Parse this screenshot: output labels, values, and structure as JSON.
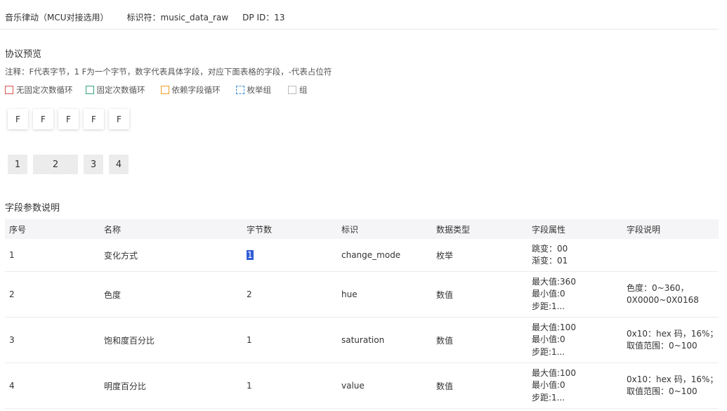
{
  "header": {
    "title": "音乐律动（MCU对接选用）",
    "identifier": "标识符：music_data_raw",
    "dp_id": "DP ID：13"
  },
  "protocol": {
    "title": "协议预览",
    "note": "注释：F代表字节，1 F为一个字节，数字代表具体字段，对应下面表格的字段，-代表占位符",
    "legend": [
      {
        "label": "无固定次数循环",
        "color": "#d9534f",
        "style": "solid"
      },
      {
        "label": "固定次数循环",
        "color": "#3aa17e",
        "style": "solid"
      },
      {
        "label": "依赖字段循环",
        "color": "#f0a020",
        "style": "solid"
      },
      {
        "label": "枚举组",
        "color": "#3b8fd9",
        "style": "dashed"
      },
      {
        "label": "组",
        "color": "#bbbbbb",
        "style": "solid"
      }
    ],
    "bytes": [
      "F",
      "F",
      "F",
      "F",
      "F"
    ],
    "fields": [
      {
        "label": "1",
        "bytes": 1
      },
      {
        "label": "2",
        "bytes": 2
      },
      {
        "label": "3",
        "bytes": 1
      },
      {
        "label": "4",
        "bytes": 1
      }
    ]
  },
  "fields_section": {
    "title": "字段参数说明",
    "columns": [
      "序号",
      "名称",
      "字节数",
      "标识",
      "数据类型",
      "字段属性",
      "字段说明"
    ],
    "rows": [
      {
        "no": "1",
        "name": "变化方式",
        "bytes": "1",
        "id": "change_mode",
        "type": "枚举",
        "attrs": [
          "跳变：00",
          "渐变：01"
        ],
        "desc": []
      },
      {
        "no": "2",
        "name": "色度",
        "bytes": "2",
        "id": "hue",
        "type": "数值",
        "attrs": [
          "最大值:360",
          "最小值:0",
          "步距:1..."
        ],
        "desc": [
          "色度：0~360，",
          "0X0000~0X0168"
        ]
      },
      {
        "no": "3",
        "name": "饱和度百分比",
        "bytes": "1",
        "id": "saturation",
        "type": "数值",
        "attrs": [
          "最大值:100",
          "最小值:0",
          "步距:1..."
        ],
        "desc": [
          "0x10：hex 码，16%；",
          "取值范围：0~100"
        ]
      },
      {
        "no": "4",
        "name": "明度百分比",
        "bytes": "1",
        "id": "value",
        "type": "数值",
        "attrs": [
          "最大值:100",
          "最小值:0",
          "步距:1..."
        ],
        "desc": [
          "0x10：hex 码，16%；",
          "取值范围：0~100"
        ]
      }
    ]
  }
}
